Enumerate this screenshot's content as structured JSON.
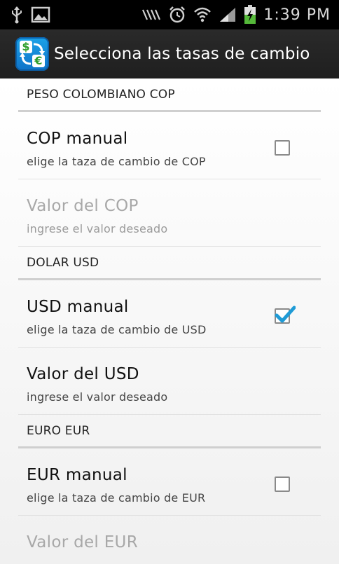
{
  "status_bar": {
    "time": "1:39 PM",
    "icons": [
      "usb-icon",
      "gallery-icon",
      "vibrate-icon",
      "alarm-icon",
      "wifi-icon",
      "signal-icon",
      "battery-charging-icon"
    ]
  },
  "app": {
    "title": "Selecciona las tasas de cambio",
    "icon": "currency-exchange-icon"
  },
  "sections": [
    {
      "header": "PESO COLOMBIANO COP",
      "items": [
        {
          "title": "COP manual",
          "summary": "elige la taza de cambio de COP",
          "type": "checkbox",
          "checked": false,
          "enabled": true
        },
        {
          "title": "Valor del COP",
          "summary": "ingrese el valor deseado",
          "type": "edit",
          "enabled": false
        }
      ]
    },
    {
      "header": "DOLAR USD",
      "items": [
        {
          "title": "USD manual",
          "summary": "elige la taza de cambio de USD",
          "type": "checkbox",
          "checked": true,
          "enabled": true
        },
        {
          "title": "Valor del USD",
          "summary": "ingrese el valor deseado",
          "type": "edit",
          "enabled": true
        }
      ]
    },
    {
      "header": "EURO EUR",
      "items": [
        {
          "title": "EUR manual",
          "summary": "elige la taza de cambio de EUR",
          "type": "checkbox",
          "checked": false,
          "enabled": true
        },
        {
          "title": "Valor del EUR",
          "type": "edit",
          "enabled": false
        }
      ]
    }
  ],
  "colors": {
    "checkmark": "#1f9bd6",
    "status_bar": "#000000",
    "title_bar": "#262626",
    "disabled_text": "#a8a8a8"
  }
}
